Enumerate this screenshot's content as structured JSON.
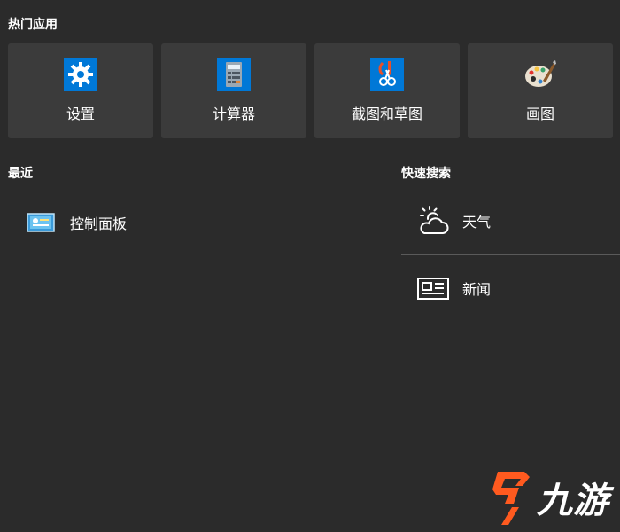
{
  "hot_apps": {
    "title": "热门应用",
    "items": [
      {
        "label": "设置",
        "icon": "gear-icon"
      },
      {
        "label": "计算器",
        "icon": "calculator-icon"
      },
      {
        "label": "截图和草图",
        "icon": "snip-sketch-icon"
      },
      {
        "label": "画图",
        "icon": "paint-palette-icon"
      }
    ]
  },
  "recent": {
    "title": "最近",
    "items": [
      {
        "label": "控制面板",
        "icon": "control-panel-icon"
      }
    ]
  },
  "quick_search": {
    "title": "快速搜索",
    "items": [
      {
        "label": "天气",
        "icon": "weather-icon"
      },
      {
        "label": "新闻",
        "icon": "news-icon"
      }
    ]
  },
  "watermark": {
    "text": "九游"
  },
  "colors": {
    "background": "#2b2b2b",
    "tile": "#3b3b3b",
    "accent_blue": "#0078d7",
    "divider": "#5a5a5a",
    "logo_orange": "#ff5a1f"
  }
}
